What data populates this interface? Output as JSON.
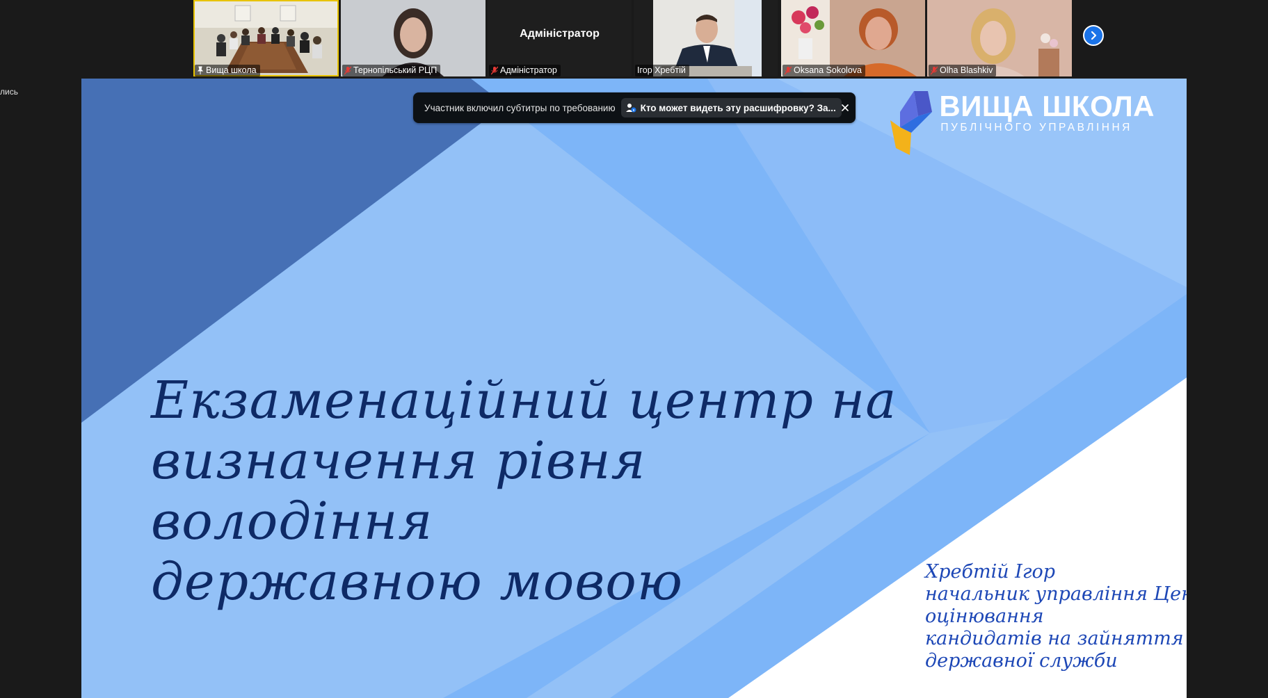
{
  "side_label": "лись",
  "participants": [
    {
      "name": "Вища школа",
      "active": true
    },
    {
      "name": "Тернопільський РЦП"
    },
    {
      "name": "Адміністратор",
      "center_label": "Адміністратор"
    },
    {
      "name": "Ігор Хребтій"
    },
    {
      "name": "Oksana Sokolova"
    },
    {
      "name": "Olha Blashkiv"
    }
  ],
  "caption_banner": {
    "message": "Участник включил субтитры по требованию",
    "link_label": "Кто может видеть эту расшифровку? За..."
  },
  "logo": {
    "title": "ВИЩА ШКОЛА",
    "subtitle": "ПУБЛІЧНОГО УПРАВЛІННЯ"
  },
  "slide": {
    "title_lines": [
      "Екзаменаційний центр на",
      "визначення рівня володіння",
      "державною мовою"
    ],
    "presenter_lines": [
      "Хребтій Ігор",
      "начальник управління Цент",
      "оцінювання",
      "кандидатів на зайняття п",
      "державної служби"
    ]
  },
  "colors": {
    "slide_light": "#93c1f7",
    "slide_mid": "#7db5f8",
    "slide_dark": "#4670b5",
    "title": "#0e2a66",
    "presenter": "#1d47b6",
    "accent": "#1a73e8"
  }
}
